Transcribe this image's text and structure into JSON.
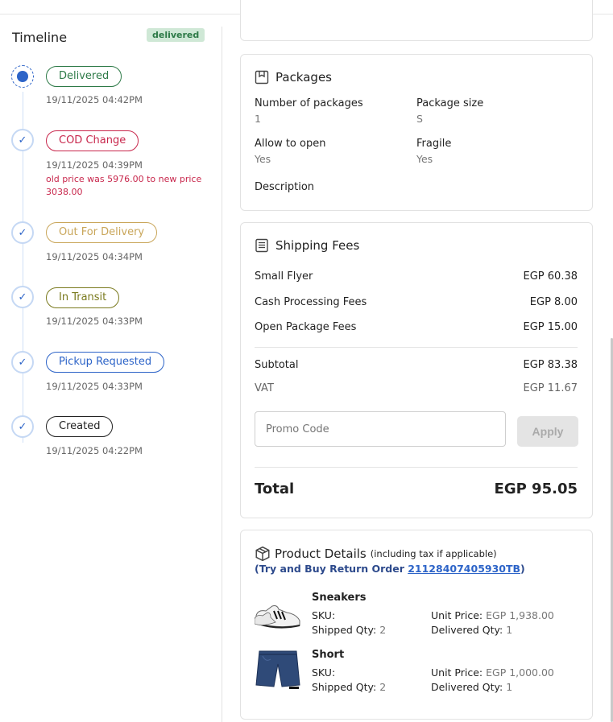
{
  "timeline": {
    "title": "Timeline",
    "status_badge": "delivered",
    "events": [
      {
        "label": "Delivered",
        "time": "19/11/2025 04:42PM",
        "note": ""
      },
      {
        "label": "COD Change",
        "time": "19/11/2025 04:39PM",
        "note": "old price was 5976.00 to new price 3038.00"
      },
      {
        "label": "Out For Delivery",
        "time": "19/11/2025 04:34PM",
        "note": ""
      },
      {
        "label": "In Transit",
        "time": "19/11/2025 04:33PM",
        "note": ""
      },
      {
        "label": "Pickup Requested",
        "time": "19/11/2025 04:33PM",
        "note": ""
      },
      {
        "label": "Created",
        "time": "19/11/2025 04:22PM",
        "note": ""
      }
    ]
  },
  "packages": {
    "title": "Packages",
    "number_label": "Number of packages",
    "number_value": "1",
    "size_label": "Package size",
    "size_value": "S",
    "open_label": "Allow to open",
    "open_value": "Yes",
    "fragile_label": "Fragile",
    "fragile_value": "Yes",
    "description_label": "Description"
  },
  "shipping": {
    "title": "Shipping Fees",
    "fees": [
      {
        "label": "Small Flyer",
        "value": "EGP 60.38"
      },
      {
        "label": "Cash Processing Fees",
        "value": "EGP 8.00"
      },
      {
        "label": "Open Package Fees",
        "value": "EGP 15.00"
      }
    ],
    "subtotal_label": "Subtotal",
    "subtotal_value": "EGP 83.38",
    "vat_label": "VAT",
    "vat_value": "EGP 11.67",
    "promo_placeholder": "Promo Code",
    "apply_label": "Apply",
    "total_label": "Total",
    "total_value": "EGP 95.05"
  },
  "products": {
    "title": "Product Details",
    "title_note": "(including tax if applicable)",
    "return_prefix": "(Try and Buy Return Order ",
    "return_link": "21128407405930TB",
    "return_suffix": ")",
    "items": [
      {
        "name": "Sneakers",
        "sku_label": "SKU:",
        "sku": "",
        "unit_price_label": "Unit Price:",
        "unit_price": "EGP 1,938.00",
        "shipped_label": "Shipped Qty:",
        "shipped": "2",
        "delivered_label": "Delivered Qty:",
        "delivered": "1"
      },
      {
        "name": "Short",
        "sku_label": "SKU:",
        "sku": "",
        "unit_price_label": "Unit Price:",
        "unit_price": "EGP 1,000.00",
        "shipped_label": "Shipped Qty:",
        "shipped": "2",
        "delivered_label": "Delivered Qty:",
        "delivered": "1"
      }
    ]
  },
  "colors": {
    "accent": "#2d64c8",
    "delivered": "#2d7a47",
    "cod_change": "#c8274c",
    "out_for_delivery": "#c9a65a",
    "in_transit": "#7a7a1e",
    "pickup_requested": "#2d64c8",
    "created": "#222222"
  }
}
